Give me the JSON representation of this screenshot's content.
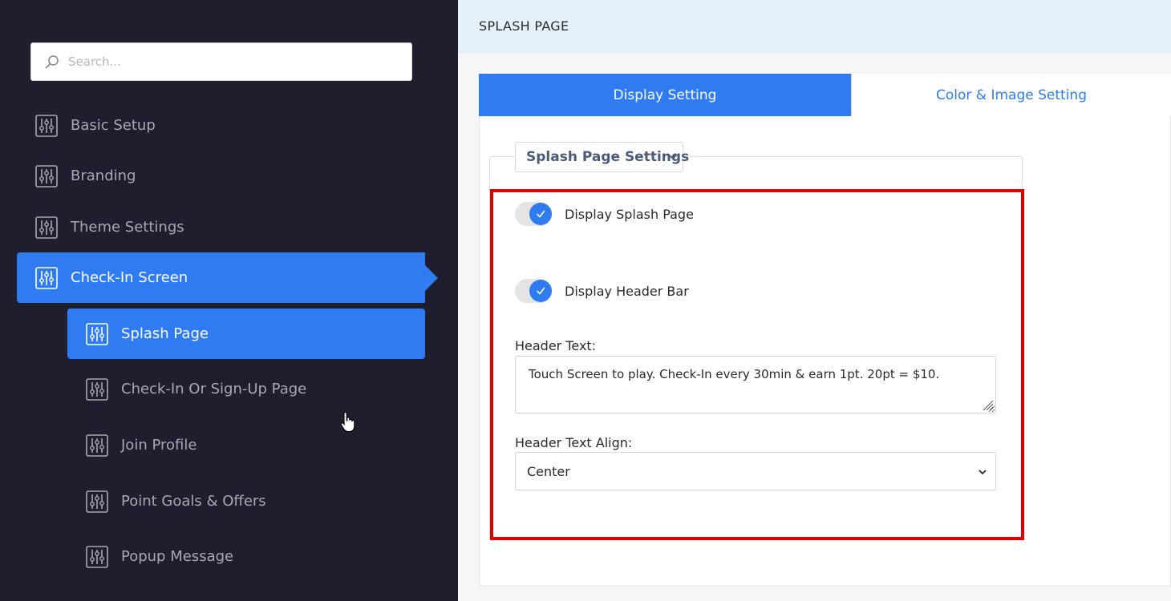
{
  "sidebar": {
    "search": {
      "placeholder": "Search..."
    },
    "items": [
      {
        "label": "Basic Setup"
      },
      {
        "label": "Branding"
      },
      {
        "label": "Theme Settings"
      },
      {
        "label": "Check-In Screen"
      }
    ],
    "sub_items": [
      {
        "label": "Splash Page"
      },
      {
        "label": "Check-In Or Sign-Up Page"
      },
      {
        "label": "Join Profile"
      },
      {
        "label": "Point Goals & Offers"
      },
      {
        "label": "Popup Message"
      }
    ]
  },
  "main": {
    "header_title": "SPLASH PAGE",
    "tabs": [
      {
        "label": "Display Setting",
        "active": true
      },
      {
        "label": "Color & Image Setting",
        "active": false
      }
    ],
    "section_title": "Splash Page Settings",
    "toggles": [
      {
        "label": "Display Splash Page",
        "on": true
      },
      {
        "label": "Display Header Bar",
        "on": true
      }
    ],
    "header_text": {
      "label": "Header Text:",
      "value": "Touch Screen to play. Check-In every 30min & earn 1pt. 20pt = $10."
    },
    "header_align": {
      "label": "Header Text Align:",
      "value": "Center"
    }
  },
  "colors": {
    "sidebar_bg": "#1f1e2e",
    "accent": "#2f7cf2",
    "highlight": "#e00000",
    "header_bg": "#e5f1fa"
  },
  "icons": {
    "search": "search-icon",
    "nav": "sliders-icon",
    "check": "check-icon",
    "chevron": "chevron-down-icon"
  }
}
